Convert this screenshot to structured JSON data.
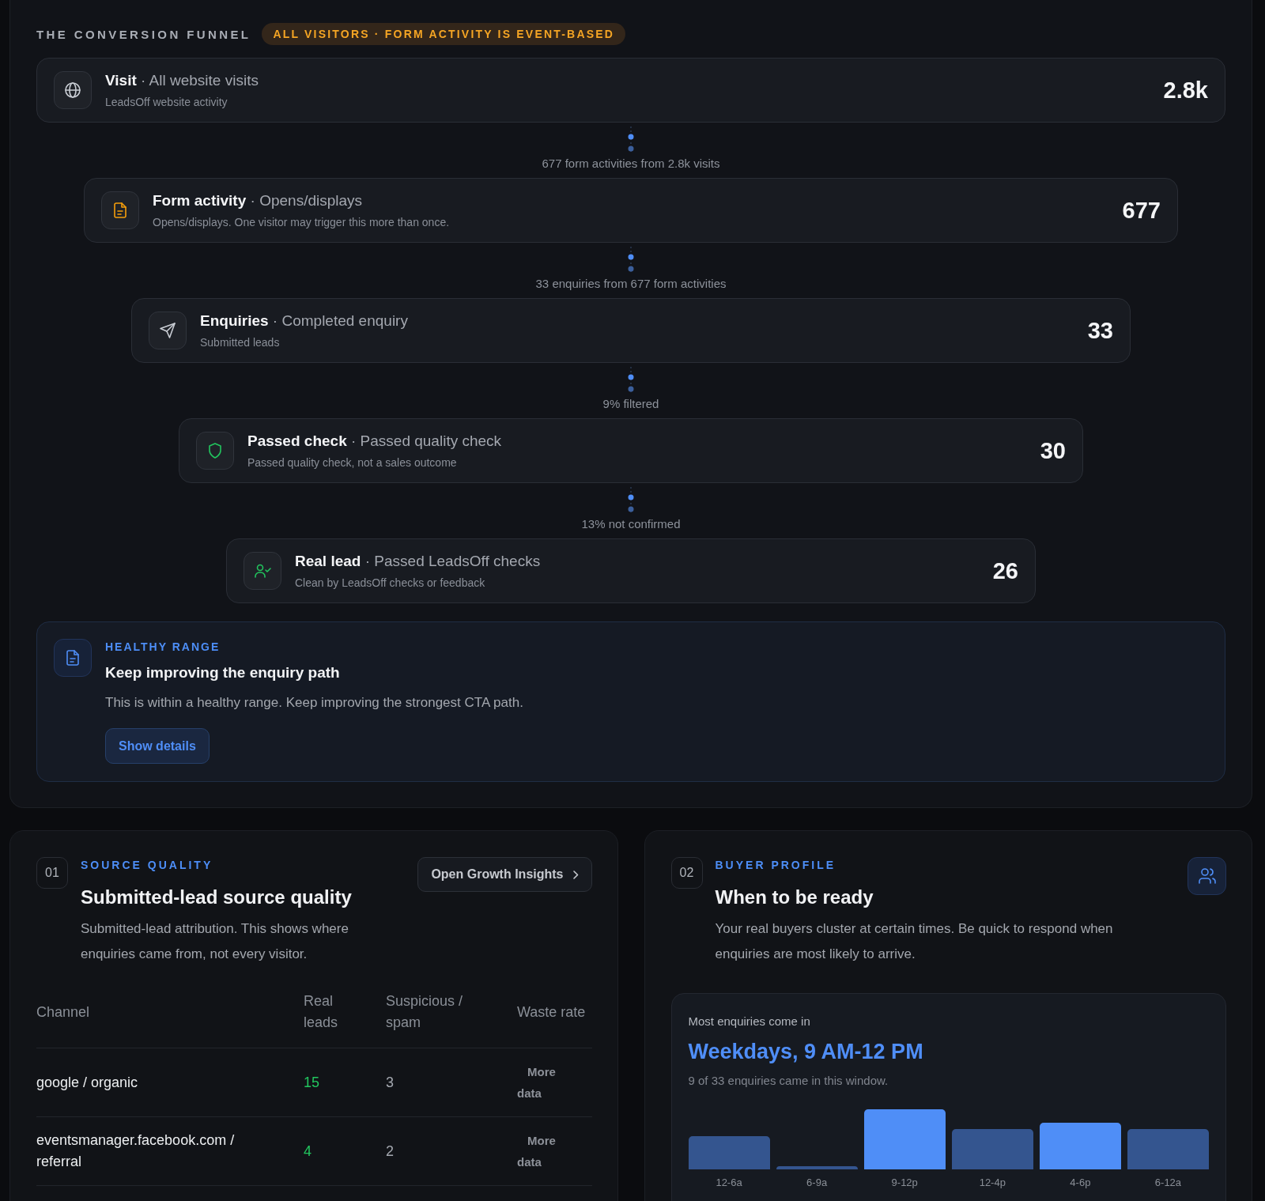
{
  "funnel": {
    "title": "THE CONVERSION FUNNEL",
    "badge": "ALL VISITORS · FORM ACTIVITY IS EVENT-BASED",
    "steps": [
      {
        "kind": "visit",
        "title": "**Visit** · All website visits",
        "note": "LeadsOff website activity",
        "value": "2.8k"
      },
      {
        "lead_in": "677 form activities from 2.8k visits",
        "kind": "form",
        "title": "**Form activity** · Opens/displays",
        "note": "Opens/displays. One visitor may trigger this more than once.",
        "value": "677"
      },
      {
        "lead_in": "33 enquiries from 677 form activities",
        "kind": "enquiry",
        "title": "**Enquiries** · Completed enquiry",
        "note": "Submitted leads",
        "value": "33"
      },
      {
        "lead_in": "9% filtered",
        "kind": "check",
        "title": "**Passed check** · Passed quality check",
        "note": "Passed quality check, not a sales outcome",
        "value": "30"
      },
      {
        "lead_in": "13% not confirmed",
        "kind": "lead",
        "title": "**Real lead** · Passed LeadsOff checks",
        "note": "Clean by LeadsOff checks or feedback",
        "value": "26"
      }
    ]
  },
  "insight": {
    "label": "HEALTHY RANGE",
    "title": "Keep improving the enquiry path",
    "text": "This is within a healthy range. Keep improving the strongest CTA path.",
    "button": "Show details"
  },
  "source_quality": {
    "number": "01",
    "label": "SOURCE QUALITY",
    "title": "Submitted-lead source quality",
    "description": "Submitted-lead attribution. This shows where enquiries came from, not every visitor.",
    "button": "Open Growth Insights",
    "columns": [
      "Channel",
      "Real leads",
      "Suspicious / spam",
      "Waste rate"
    ],
    "rows": [
      {
        "channel": "google / organic",
        "real_leads": "15",
        "suspicious": "3",
        "waste_rate": "More data"
      },
      {
        "channel": "eventsmanager.facebook.com / referral",
        "real_leads": "4",
        "suspicious": "2",
        "waste_rate": "More data"
      }
    ]
  },
  "buyer_profile": {
    "number": "02",
    "label": "BUYER PROFILE",
    "title": "When to be ready",
    "description": "Your real buyers cluster at certain times. Be quick to respond when enquiries are most likely to arrive.",
    "peak": {
      "caption": "Most enquiries come in",
      "window": "Weekdays, 9 AM-12 PM",
      "detail": "9 of 33 enquiries came in this window."
    },
    "bars": [
      {
        "label": "12-6a",
        "highlighted": false
      },
      {
        "label": "6-9a",
        "highlighted": false
      },
      {
        "label": "9-12p",
        "highlighted": true
      },
      {
        "label": "12-4p",
        "highlighted": false
      },
      {
        "label": "4-6p",
        "highlighted": true
      },
      {
        "label": "6-12a",
        "highlighted": false
      }
    ]
  }
}
